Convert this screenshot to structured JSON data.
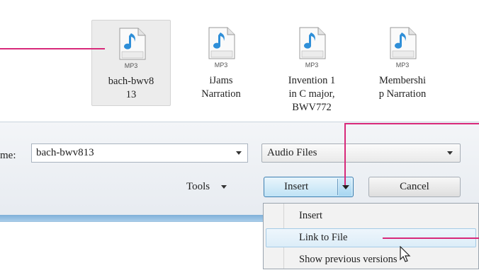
{
  "files": [
    {
      "name_line1": "bach-bwv8",
      "name_line2": "13",
      "badge": "MP3",
      "selected": true,
      "icon": "mp3-file-icon"
    },
    {
      "name_line1": "iJams",
      "name_line2": "Narration",
      "badge": "MP3",
      "selected": false,
      "icon": "mp3-file-icon"
    },
    {
      "name_line1": "Invention 1",
      "name_line2": "in C major,",
      "name_line3": "BWV772",
      "badge": "MP3",
      "selected": false,
      "icon": "mp3-file-icon"
    },
    {
      "name_line1": "Membershi",
      "name_line2": "p Narration",
      "badge": "MP3",
      "selected": false,
      "icon": "mp3-file-icon"
    }
  ],
  "filename_label": "me:",
  "filename_value": "bach-bwv813",
  "filetype_value": "Audio Files",
  "tools_label": "Tools",
  "insert_label": "Insert",
  "cancel_label": "Cancel",
  "insert_menu": [
    {
      "label": "Insert",
      "highlighted": false
    },
    {
      "label": "Link to File",
      "highlighted": true
    },
    {
      "label": "Show previous versions",
      "highlighted": false
    }
  ],
  "colors": {
    "callout": "#d8297a",
    "selection_blue": "#3c7fb1",
    "note_blue": "#2f8fd8"
  }
}
